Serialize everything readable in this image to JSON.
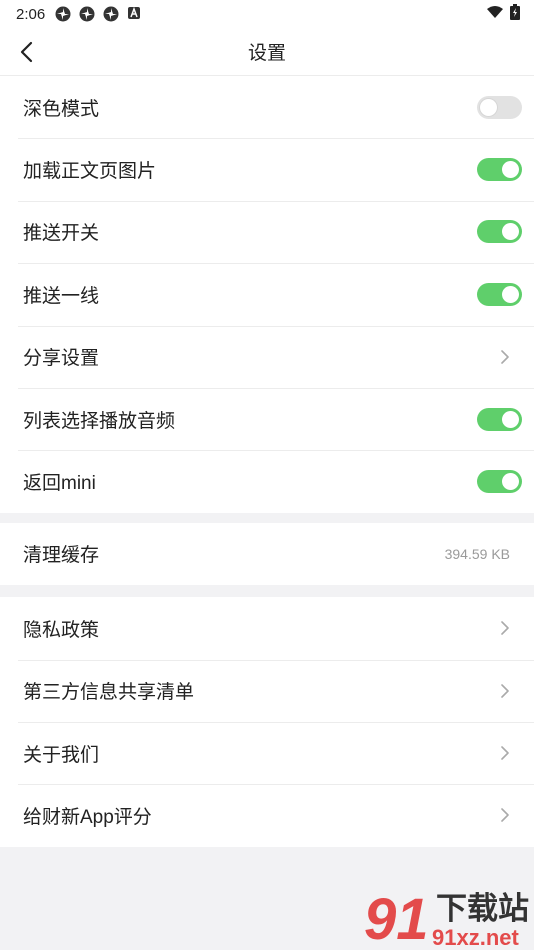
{
  "status_bar": {
    "time": "2:06",
    "icons": [
      "pinwheel-icon",
      "pinwheel-icon",
      "pinwheel-icon",
      "letter-a-icon"
    ],
    "right_icons": [
      "wifi-icon",
      "battery-icon"
    ]
  },
  "header": {
    "title": "设置",
    "back_icon": "back-arrow-icon"
  },
  "colors": {
    "toggle_on": "#5fcf6b",
    "toggle_off": "#e2e2e2",
    "background": "#f2f2f4"
  },
  "group1": {
    "items": [
      {
        "label": "深色模式",
        "control": "toggle",
        "on": false
      },
      {
        "label": "加载正文页图片",
        "control": "toggle",
        "on": true
      },
      {
        "label": "推送开关",
        "control": "toggle",
        "on": true
      },
      {
        "label": "推送一线",
        "control": "toggle",
        "on": true
      },
      {
        "label": "分享设置",
        "control": "chevron"
      },
      {
        "label": "列表选择播放音频",
        "control": "toggle",
        "on": true
      },
      {
        "label": "返回mini",
        "control": "toggle",
        "on": true
      }
    ]
  },
  "group2": {
    "items": [
      {
        "label": "清理缓存",
        "value": "394.59 KB"
      }
    ]
  },
  "group3": {
    "items": [
      {
        "label": "隐私政策",
        "control": "chevron"
      },
      {
        "label": "第三方信息共享清单",
        "control": "chevron"
      },
      {
        "label": "关于我们",
        "control": "chevron"
      },
      {
        "label": "给财新App评分",
        "control": "chevron"
      }
    ]
  },
  "watermark": {
    "logo": "91",
    "text": "下载站",
    "url": "91xz.net"
  }
}
